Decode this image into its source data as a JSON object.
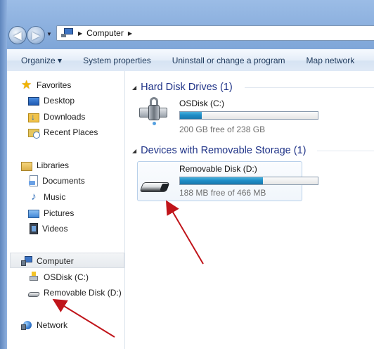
{
  "address": {
    "path": [
      "Computer"
    ]
  },
  "toolbar": {
    "items": [
      "Organize ▾",
      "System properties",
      "Uninstall or change a program",
      "Map network"
    ]
  },
  "nav": {
    "favorites": "Favorites",
    "desktop": "Desktop",
    "downloads": "Downloads",
    "recent": "Recent Places",
    "libraries": "Libraries",
    "documents": "Documents",
    "music": "Music",
    "pictures": "Pictures",
    "videos": "Videos",
    "computer": "Computer",
    "osdisk": "OSDisk (C:)",
    "removable": "Removable Disk (D:)",
    "network": "Network"
  },
  "groups": {
    "hdd": "Hard Disk Drives (1)",
    "removable": "Devices with Removable Storage (1)"
  },
  "drives": [
    {
      "name": "OSDisk (C:)",
      "free_text": "200 GB free of 238 GB",
      "used_fraction": 0.16
    },
    {
      "name": "Removable Disk (D:)",
      "free_text": "188 MB free of 466 MB",
      "used_fraction": 0.6
    }
  ],
  "colors": {
    "accent": "#1f8ec8",
    "annotation_arrow": "#c0141a",
    "group_header": "#1e3287"
  }
}
